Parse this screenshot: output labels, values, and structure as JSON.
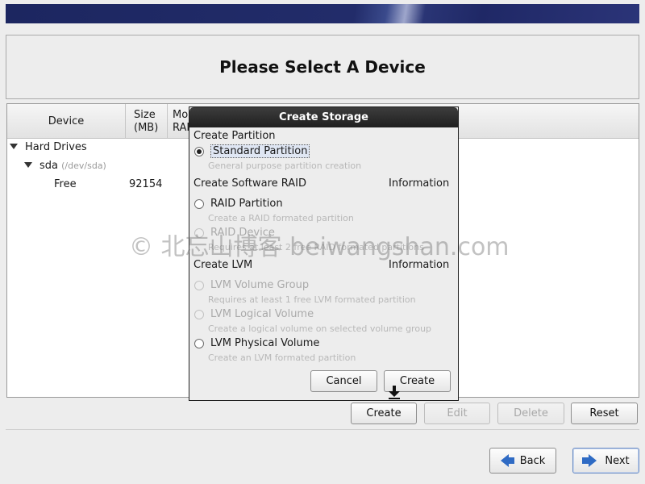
{
  "page": {
    "title": "Please Select A Device"
  },
  "tree": {
    "headers": {
      "device": "Device",
      "size_line1": "Size",
      "size_line2": "(MB)",
      "mount_line1": "Mo",
      "mount_line2": "RAI"
    },
    "group": "Hard Drives",
    "disk": {
      "name": "sda",
      "path": "(/dev/sda)"
    },
    "free_row": {
      "label": "Free",
      "size": "92154"
    }
  },
  "main_buttons": {
    "create": "Create",
    "edit": "Edit",
    "delete": "Delete",
    "reset": "Reset"
  },
  "nav_buttons": {
    "back": "Back",
    "next": "Next"
  },
  "dialog": {
    "title": "Create Storage",
    "partition_section": "Create Partition",
    "standard_partition": {
      "label": "Standard Partition",
      "desc": "General purpose partition creation",
      "selected": true
    },
    "raid_section": "Create Software RAID",
    "raid_info": "Information",
    "raid_partition": {
      "label": "RAID Partition",
      "desc": "Create a RAID formated partition"
    },
    "raid_device": {
      "label": "RAID Device",
      "desc": "Requires at least 2 free RAID formated partitions"
    },
    "lvm_section": "Create LVM",
    "lvm_info": "Information",
    "lvm_volume_group": {
      "label": "LVM Volume Group",
      "desc": "Requires at least 1 free LVM formated partition"
    },
    "lvm_logical_volume": {
      "label": "LVM Logical Volume",
      "desc": "Create a logical volume on selected volume group"
    },
    "lvm_physical_volume": {
      "label": "LVM Physical Volume",
      "desc": "Create an LVM formated partition"
    },
    "cancel": "Cancel",
    "create": "Create"
  },
  "watermark": "© 北忘山博客 beiwangshan.com",
  "colors": {
    "banner": "#1f2866",
    "dialog_titlebar": "#2a2a2a",
    "nav_arrow": "#2f6bc4"
  }
}
